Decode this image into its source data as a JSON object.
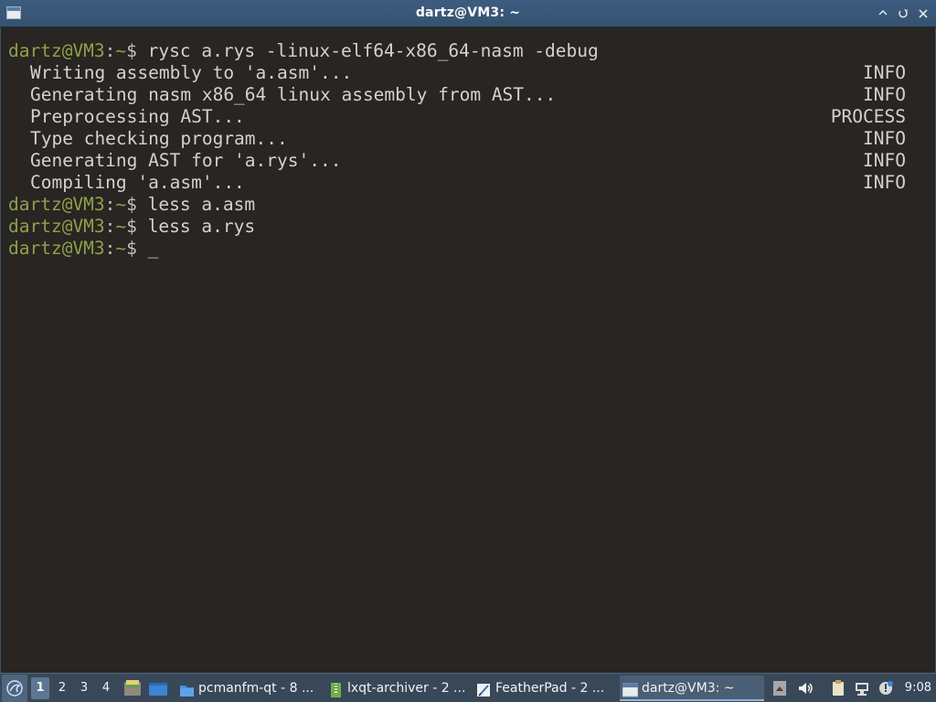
{
  "window": {
    "title": "dartz@VM3: ~",
    "buttons": {
      "minimize": "⌃",
      "maximize": "⟲",
      "close": "✕"
    }
  },
  "terminal": {
    "lines": [
      {
        "kind": "prompt",
        "user": "dartz@VM3",
        "sep": ":",
        "path": "~",
        "symbol": "$",
        "command": " rysc a.rys -linux-elf64-x86_64-nasm -debug"
      },
      {
        "kind": "log",
        "message": "Writing assembly to 'a.asm'...",
        "level": "INFO"
      },
      {
        "kind": "log",
        "message": "Generating nasm x86_64 linux assembly from AST...",
        "level": "INFO"
      },
      {
        "kind": "log",
        "message": "Preprocessing AST...",
        "level": "PROCESS"
      },
      {
        "kind": "log",
        "message": "Type checking program...",
        "level": "INFO"
      },
      {
        "kind": "log",
        "message": "Generating AST for 'a.rys'...",
        "level": "INFO"
      },
      {
        "kind": "log",
        "message": "Compiling 'a.asm'...",
        "level": "INFO"
      },
      {
        "kind": "prompt",
        "user": "dartz@VM3",
        "sep": ":",
        "path": "~",
        "symbol": "$",
        "command": " less a.asm"
      },
      {
        "kind": "prompt",
        "user": "dartz@VM3",
        "sep": ":",
        "path": "~",
        "symbol": "$",
        "command": " less a.rys"
      },
      {
        "kind": "prompt",
        "user": "dartz@VM3",
        "sep": ":",
        "path": "~",
        "symbol": "$",
        "command": " ",
        "cursor": "_"
      }
    ]
  },
  "taskbar": {
    "desktops": [
      "1",
      "2",
      "3",
      "4"
    ],
    "active_desktop": "1",
    "tasks": [
      {
        "label": "pcmanfm-qt - 8 ...",
        "icon": "folder-icon"
      },
      {
        "label": "lxqt-archiver - 2 ...",
        "icon": "archive-icon"
      },
      {
        "label": "FeatherPad - 2 ...",
        "icon": "text-editor-icon"
      },
      {
        "label": "dartz@VM3: ~",
        "icon": "terminal-icon"
      }
    ],
    "clock": "9:08"
  },
  "colors": {
    "terminal_bg": "#282522",
    "terminal_fg": "#d4d2cb",
    "prompt_user": "#8fa04a",
    "titlebar": "#3a5878",
    "taskbar": "#394858"
  }
}
